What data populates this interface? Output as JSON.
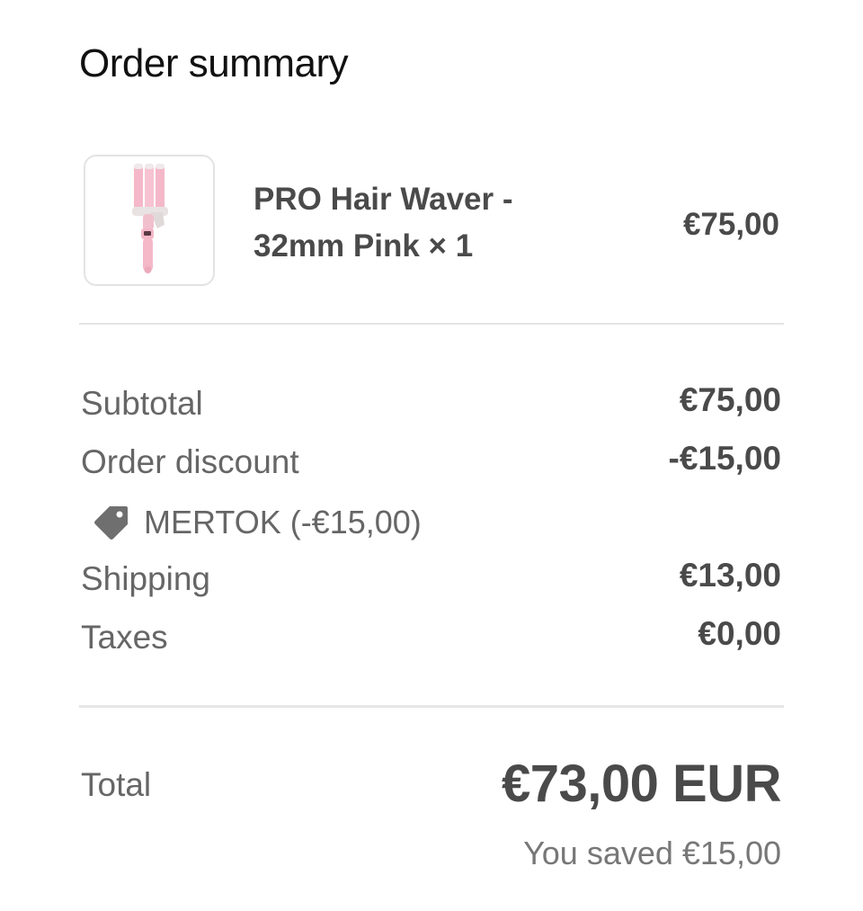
{
  "title": "Order summary",
  "product": {
    "name_line1": "PRO Hair Waver -",
    "name_line2": "32mm Pink × 1",
    "price": "€75,00",
    "image_icon": "hair-waver-image",
    "image_color": "#f4b8c8"
  },
  "summary": {
    "subtotal_label": "Subtotal",
    "subtotal_value": "€75,00",
    "discount_label": "Order discount",
    "discount_value": "-€15,00",
    "discount_code_icon": "tag-icon",
    "discount_code": "MERTOK (-€15,00)",
    "shipping_label": "Shipping",
    "shipping_value": "€13,00",
    "taxes_label": "Taxes",
    "taxes_value": "€0,00"
  },
  "total": {
    "label": "Total",
    "value": "€73,00 EUR",
    "saved": "You saved €15,00"
  },
  "colors": {
    "text_primary": "#4a4a4a",
    "text_secondary": "#666666",
    "heading": "#111111",
    "divider": "#e4e4e4"
  }
}
